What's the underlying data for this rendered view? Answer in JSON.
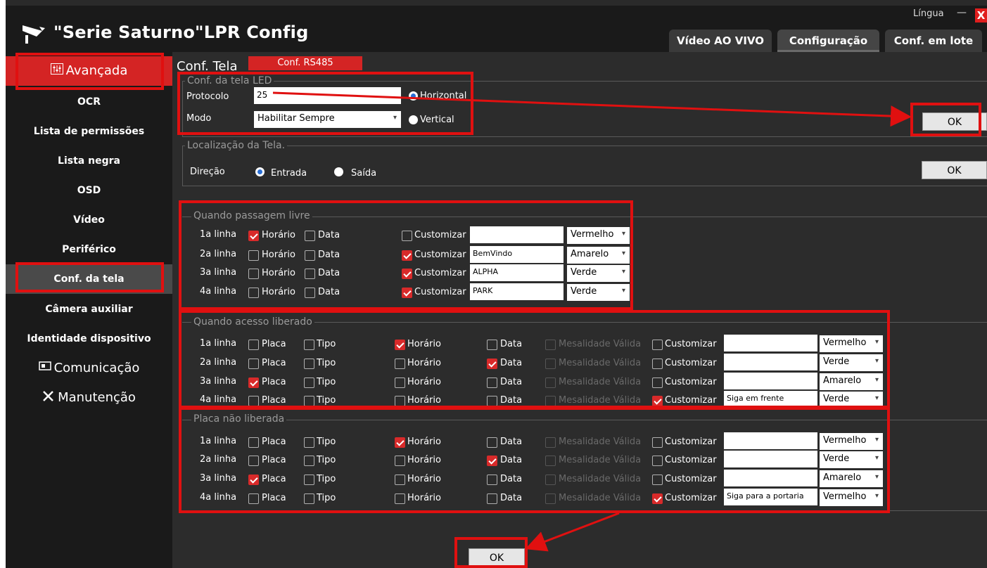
{
  "header": {
    "title": "\"Serie Saturno\"LPR Config",
    "language": "Língua",
    "minimize": "—",
    "close": "X",
    "tabs": [
      "Vídeo AO VIVO",
      "Configuração",
      "Conf. em lote"
    ],
    "active_tab": "Configuração"
  },
  "sidebar": {
    "items": [
      "Avançada",
      "OCR",
      "Lista de permissões",
      "Lista negra",
      "OSD",
      "Vídeo",
      "Periférico",
      "Conf. da tela",
      "Câmera auxiliar",
      "Identidade dispositivo",
      "Comunicação",
      "Manutenção"
    ],
    "active": "Conf. da tela"
  },
  "content": {
    "title": "Conf. Tela",
    "tab": "Conf. RS485",
    "led": {
      "group": "Conf. da tela LED",
      "protocol_label": "Protocolo",
      "protocol_value": "25",
      "mode_label": "Modo",
      "mode_value": "Habilitar Sempre",
      "horizontal": "Horizontal",
      "vertical": "Vertical",
      "ok": "OK"
    },
    "location": {
      "group": "Localização da Tela.",
      "direction_label": "Direção",
      "entrada": "Entrada",
      "saida": "Saída",
      "ok": "OK"
    },
    "free": {
      "group": "Quando passagem livre",
      "rows": [
        {
          "line": "1a linha",
          "horario": true,
          "data": false,
          "custom": false,
          "text": "",
          "color": "Vermelho"
        },
        {
          "line": "2a linha",
          "horario": false,
          "data": false,
          "custom": true,
          "text": "BemVindo",
          "color": "Amarelo"
        },
        {
          "line": "3a linha",
          "horario": false,
          "data": false,
          "custom": true,
          "text": "ALPHA",
          "color": "Verde"
        },
        {
          "line": "4a linha",
          "horario": false,
          "data": false,
          "custom": true,
          "text": "PARK",
          "color": "Verde"
        }
      ]
    },
    "access": {
      "group": "Quando acesso liberado",
      "rows": [
        {
          "line": "1a linha",
          "placa": false,
          "tipo": false,
          "horario": true,
          "data": false,
          "custom": false,
          "text": "",
          "color": "Vermelho"
        },
        {
          "line": "2a linha",
          "placa": false,
          "tipo": false,
          "horario": false,
          "data": true,
          "custom": false,
          "text": "",
          "color": "Verde"
        },
        {
          "line": "3a linha",
          "placa": true,
          "tipo": false,
          "horario": false,
          "data": false,
          "custom": false,
          "text": "",
          "color": "Amarelo"
        },
        {
          "line": "4a linha",
          "placa": false,
          "tipo": false,
          "horario": false,
          "data": false,
          "custom": true,
          "text": "Siga em frente",
          "color": "Verde"
        }
      ]
    },
    "denied": {
      "group": "Placa não liberada",
      "rows": [
        {
          "line": "1a linha",
          "placa": false,
          "tipo": false,
          "horario": true,
          "data": false,
          "custom": false,
          "text": "",
          "color": "Vermelho"
        },
        {
          "line": "2a linha",
          "placa": false,
          "tipo": false,
          "horario": false,
          "data": true,
          "custom": false,
          "text": "",
          "color": "Verde"
        },
        {
          "line": "3a linha",
          "placa": true,
          "tipo": false,
          "horario": false,
          "data": false,
          "custom": false,
          "text": "",
          "color": "Amarelo"
        },
        {
          "line": "4a linha",
          "placa": false,
          "tipo": false,
          "horario": false,
          "data": false,
          "custom": true,
          "text": "Siga para a portaria",
          "color": "Vermelho"
        }
      ]
    },
    "labels": {
      "horario": "Horário",
      "data": "Data",
      "customizar": "Customizar",
      "placa": "Placa",
      "tipo": "Tipo",
      "mesalidade": "Mesalidade Válida"
    },
    "ok_bottom": "OK"
  },
  "colors": {
    "accent": "#d42424",
    "highlight": "#e01010",
    "sidebar_bg": "#1a1a1a",
    "content_bg": "#2c2c2c"
  }
}
